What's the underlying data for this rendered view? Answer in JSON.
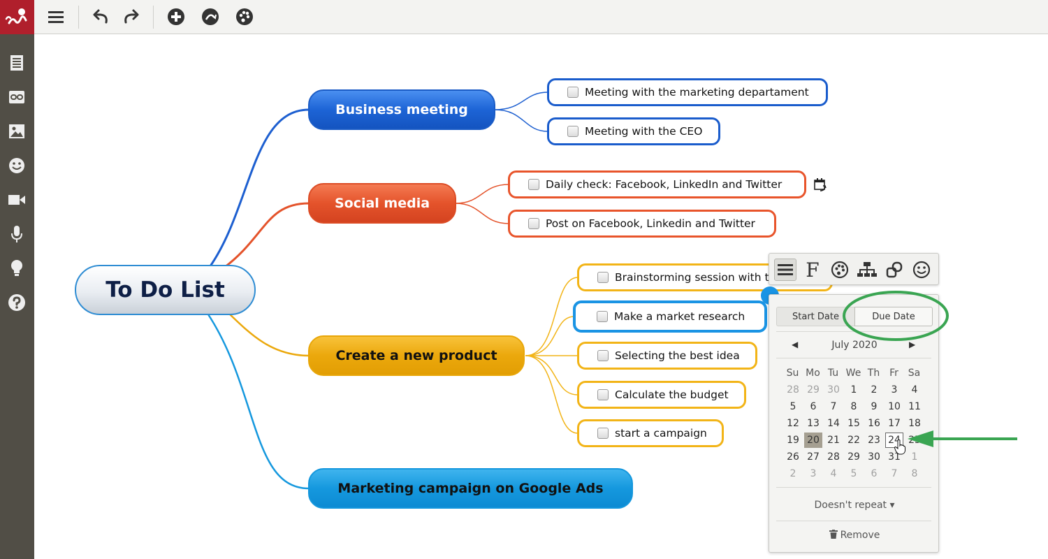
{
  "toolbar": {
    "buttons": [
      {
        "name": "menu-icon"
      },
      {
        "name": "undo-icon"
      },
      {
        "name": "redo-icon"
      },
      {
        "name": "add-icon"
      },
      {
        "name": "connect-icon"
      },
      {
        "name": "palette-icon"
      }
    ]
  },
  "sidebar": {
    "items": [
      {
        "name": "notes-icon"
      },
      {
        "name": "link-icon"
      },
      {
        "name": "image-icon"
      },
      {
        "name": "emoji-icon"
      },
      {
        "name": "video-icon"
      },
      {
        "name": "microphone-icon"
      },
      {
        "name": "lightbulb-icon"
      },
      {
        "name": "help-icon"
      }
    ]
  },
  "mindmap": {
    "central": "To Do List",
    "topics": [
      {
        "label": "Business meeting",
        "color": "#1d64d6",
        "tasks": [
          "Meeting with the marketing departament",
          "Meeting with the CEO"
        ]
      },
      {
        "label": "Social media",
        "color": "#e4532b",
        "tasks": [
          "Daily check: Facebook, LinkedIn and Twitter",
          "Post on Facebook, Linkedin and Twitter"
        ]
      },
      {
        "label": "Create a new product",
        "color": "#eba80c",
        "tasks": [
          "Brainstorming session with the team",
          "Make a market research",
          "Selecting the best idea",
          "Calculate the budget",
          "start a campaign"
        ]
      },
      {
        "label": "Marketing campaign on Google Ads",
        "color": "#1598de",
        "tasks": []
      }
    ]
  },
  "context_toolbar": {
    "buttons": [
      "lines-icon",
      "font-icon",
      "palette-icon",
      "structure-icon",
      "shape-icon",
      "emoji-icon"
    ],
    "font_glyph": "F"
  },
  "date_panel": {
    "tab_start": "Start Date",
    "tab_due": "Due Date",
    "month": "July 2020",
    "prev": "◀",
    "next": "▶",
    "weekdays": [
      "Su",
      "Mo",
      "Tu",
      "We",
      "Th",
      "Fr",
      "Sa"
    ],
    "weeks": [
      [
        [
          "28",
          "muted"
        ],
        [
          "29",
          "muted"
        ],
        [
          "30",
          "muted"
        ],
        [
          "1",
          ""
        ],
        [
          "2",
          ""
        ],
        [
          "3",
          ""
        ],
        [
          "4",
          ""
        ]
      ],
      [
        [
          "5",
          ""
        ],
        [
          "6",
          ""
        ],
        [
          "7",
          ""
        ],
        [
          "8",
          ""
        ],
        [
          "9",
          ""
        ],
        [
          "10",
          ""
        ],
        [
          "11",
          ""
        ]
      ],
      [
        [
          "12",
          ""
        ],
        [
          "13",
          ""
        ],
        [
          "14",
          ""
        ],
        [
          "15",
          ""
        ],
        [
          "16",
          ""
        ],
        [
          "17",
          ""
        ],
        [
          "18",
          ""
        ]
      ],
      [
        [
          "19",
          ""
        ],
        [
          "20",
          "today"
        ],
        [
          "21",
          ""
        ],
        [
          "22",
          ""
        ],
        [
          "23",
          ""
        ],
        [
          "24",
          "hover"
        ],
        [
          "25",
          ""
        ]
      ],
      [
        [
          "26",
          ""
        ],
        [
          "27",
          ""
        ],
        [
          "28",
          ""
        ],
        [
          "29",
          ""
        ],
        [
          "30",
          ""
        ],
        [
          "31",
          ""
        ],
        [
          "1",
          "muted"
        ]
      ],
      [
        [
          "2",
          "muted"
        ],
        [
          "3",
          "muted"
        ],
        [
          "4",
          "muted"
        ],
        [
          "5",
          "muted"
        ],
        [
          "6",
          "muted"
        ],
        [
          "7",
          "muted"
        ],
        [
          "8",
          "muted"
        ]
      ]
    ],
    "repeat": "Doesn't repeat ▾",
    "remove": "Remove"
  },
  "colors": {
    "logo": "#b01f2c",
    "sidebar": "#514e46",
    "annotation": "#3aa552"
  }
}
